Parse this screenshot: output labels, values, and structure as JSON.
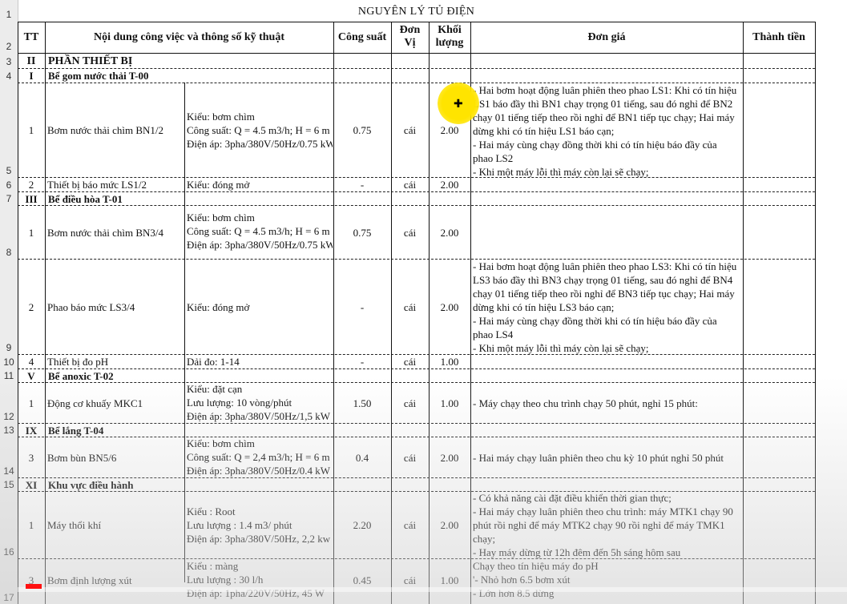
{
  "sheet": {
    "title": "NGUYÊN LÝ TỦ ĐIỆN",
    "headers": {
      "tt": "TT",
      "content": "Nội dung công việc và thông số kỹ thuật",
      "power": "Công suất",
      "unit_l1": "Đơn",
      "unit_l2": "Vị",
      "qty_l1": "Khối",
      "qty_l2": "lượng",
      "price": "Đơn giá",
      "total": "Thành tiền"
    },
    "row_numbers": [
      "1",
      "2",
      "3",
      "4",
      "5",
      "6",
      "7",
      "8",
      "9",
      "10",
      "11",
      "12",
      "13",
      "14",
      "15",
      "16",
      "17"
    ],
    "sections": {
      "s2": {
        "tt": "II",
        "name": "PHẦN THIẾT BỊ"
      },
      "s4": {
        "tt": "I",
        "name": "Bể gom nước thải T-00"
      },
      "s7": {
        "tt": "III",
        "name": "Bể điều hòa T-01"
      },
      "s11": {
        "tt": "V",
        "name": "Bể anoxic T-02"
      },
      "s13": {
        "tt": "IX",
        "name": "Bể lắng T-04"
      },
      "s15": {
        "tt": "XI",
        "name": "Khu vực điều hành"
      }
    },
    "rows": {
      "r5": {
        "tt": "1",
        "name": "Bơm nước thải chìm BN1/2",
        "spec": [
          "Kiểu: bơm chìm",
          "Công suất: Q = 4.5 m3/h; H = 6 m",
          "Điện áp: 3pha/380V/50Hz/0.75 kW"
        ],
        "power": "0.75",
        "unit": "cái",
        "qty": "2.00",
        "price": [
          "- Hai bơm hoạt động luân phiên theo phao LS1: Khi có tín hiệu",
          "LS1 báo đầy thì BN1 chạy trọng 01 tiếng, sau đó nghỉ để BN2",
          "chạy 01 tiếng tiếp theo rồi nghỉ để BN1 tiếp tục chạy; Hai máy",
          "dừng khi có tín hiệu LS1 báo cạn;",
          "- Hai máy cùng chạy đồng thời khi có tín hiệu báo đầy của",
          "phao LS2",
          "- Khi một máy lỗi thì máy còn lại sẽ chạy;"
        ]
      },
      "r6": {
        "tt": "2",
        "name": "Thiết bị báo mức LS1/2",
        "spec": [
          "Kiểu: đóng mở"
        ],
        "power": "-",
        "unit": "cái",
        "qty": "2.00",
        "price": []
      },
      "r8": {
        "tt": "1",
        "name": "Bơm nước thải chìm BN3/4",
        "spec": [
          "Kiểu: bơm chìm",
          "Công suất: Q = 4.5 m3/h; H = 6 m",
          "Điện áp: 3pha/380V/50Hz/0.75 kW"
        ],
        "power": "0.75",
        "unit": "cái",
        "qty": "2.00",
        "price": []
      },
      "r9": {
        "tt": "2",
        "name": "Phao báo mức LS3/4",
        "spec": [
          "Kiểu: đóng mở"
        ],
        "power": "-",
        "unit": "cái",
        "qty": "2.00",
        "price": [
          "- Hai bơm hoạt động luân phiên theo phao LS3: Khi có tín hiệu",
          "LS3 báo đầy thì BN3 chạy trọng 01 tiếng, sau đó nghỉ để BN4",
          "chạy 01 tiếng tiếp theo rồi nghỉ để BN3 tiếp tục chạy; Hai máy",
          "dừng khi có tín hiệu LS3 báo cạn;",
          "- Hai máy cùng chạy đồng thời khi có tín hiệu báo đầy của",
          "phao LS4",
          "- Khi một máy lỗi thì máy còn lại sẽ chạy;"
        ]
      },
      "r10": {
        "tt": "4",
        "name": "Thiết bị đo pH",
        "spec": [
          "Dải đo: 1-14"
        ],
        "power": "-",
        "unit": "cái",
        "qty": "1.00",
        "price": []
      },
      "r12": {
        "tt": "1",
        "name": "Động cơ khuấy MKC1",
        "spec": [
          "Kiểu: đặt cạn",
          "Lưu lượng: 10 vòng/phút",
          "Điện áp: 3pha/380V/50Hz/1,5 kW"
        ],
        "power": "1.50",
        "unit": "cái",
        "qty": "1.00",
        "price": [
          "- Máy chạy theo chu trình chạy 50 phút, nghỉ 15 phút:"
        ]
      },
      "r14": {
        "tt": "3",
        "name": "Bơm bùn BN5/6",
        "spec": [
          "Kiểu: bơm chìm",
          "Công suất: Q = 2,4 m3/h; H = 6 m",
          "Điện áp: 3pha/380V/50Hz/0.4 kW"
        ],
        "power": "0.4",
        "unit": "cái",
        "qty": "2.00",
        "price": [
          "- Hai máy chạy luân phiên theo chu kỳ 10 phút nghỉ 50 phút"
        ]
      },
      "r16": {
        "tt": "1",
        "name": "Máy thổi khí",
        "spec": [
          "Kiểu : Root",
          "Lưu lượng : 1.4 m3/ phút",
          "Điện áp: 3pha/380V/50Hz, 2,2 kw"
        ],
        "power": "2.20",
        "unit": "cái",
        "qty": "2.00",
        "price": [
          " - Có khả năng cài đặt điều khiển thời gian thực;",
          "- Hai máy chạy luân phiên theo chu trình: máy MTK1 chạy 90",
          "phút rồi nghỉ để máy MTK2 chạy 90 rồi nghỉ để máy TMK1",
          "chạy;",
          "- Hay máy dừng từ 12h đêm đến 5h sáng hôm sau"
        ]
      },
      "r17": {
        "tt": "3",
        "name": "Bơm định lượng xút",
        "spec": [
          "Kiểu : màng",
          "Lưu lượng : 30 l/h",
          "Điện áp: 1pha/220V/50Hz, 45 W"
        ],
        "power": "0.45",
        "unit": "cái",
        "qty": "1.00",
        "price": [
          " Chạy theo tín hiệu máy đo pH",
          "'- Nhỏ hơn 6.5 bơm xút",
          "- Lớn hơn 8.5 dừng"
        ]
      }
    }
  },
  "colors": {
    "cursor_highlight": "#ffe400",
    "progress_marker": "#ff1010"
  }
}
